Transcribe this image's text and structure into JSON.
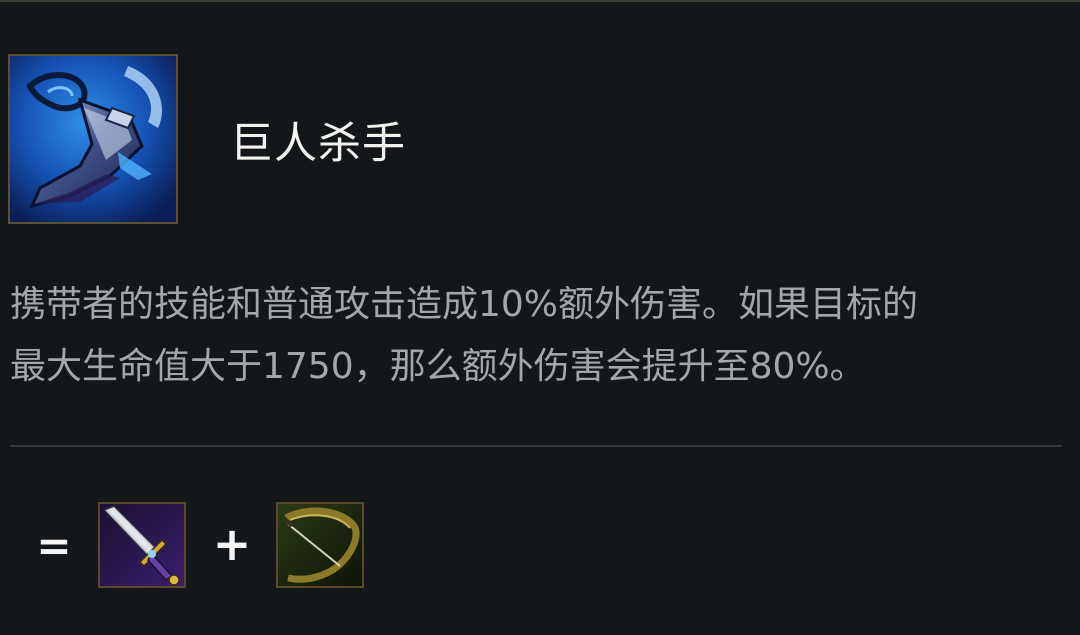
{
  "item": {
    "name": "巨人杀手",
    "icon": "giant-slayer-icon"
  },
  "description": {
    "line1": "携带者的技能和普通攻击造成10%额外伤害。如果目标的",
    "line2": "最大生命值大于1750，那么额外伤害会提升至80%。"
  },
  "recipe": {
    "equals": "=",
    "plus": "+",
    "components": [
      {
        "icon": "bf-sword-icon"
      },
      {
        "icon": "recurve-bow-icon"
      }
    ]
  },
  "colors": {
    "background": "#14171a",
    "title": "#f2f2ee",
    "description": "#a4a6a7",
    "frame": "#5c5033",
    "divider": "#34393c"
  }
}
